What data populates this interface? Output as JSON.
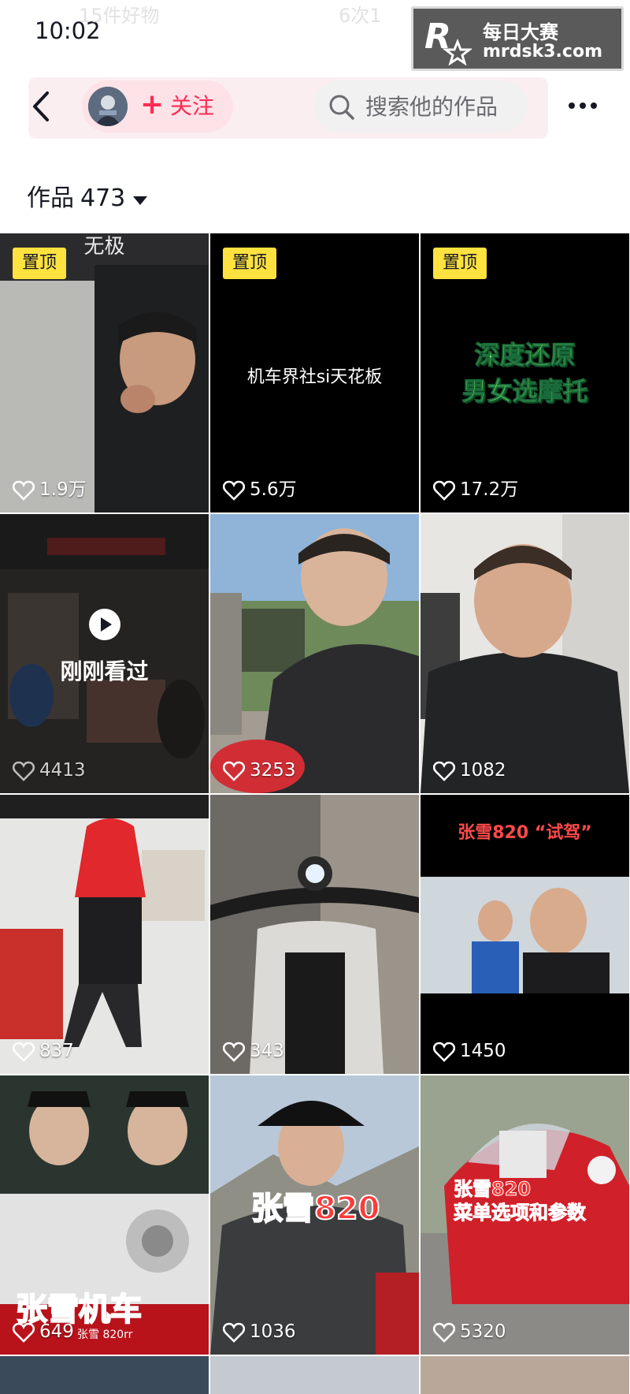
{
  "status_bar": {
    "time": "10:02",
    "ghost_text_left": "15件好物",
    "ghost_text_right": "6次1"
  },
  "watermark": {
    "logo_letter": "R",
    "title": "每日大赛",
    "url": "mrdsk3.com"
  },
  "nav": {
    "follow_label": "关注",
    "follow_plus": "+",
    "search_placeholder": "搜索他的作品"
  },
  "works_header": {
    "label": "作品",
    "count": "473"
  },
  "tiles": [
    {
      "pinned": true,
      "pin_label": "置顶",
      "top_text": "无极",
      "likes": "1.9万"
    },
    {
      "pinned": true,
      "pin_label": "置顶",
      "caption": "机车界社si天花板",
      "likes": "5.6万"
    },
    {
      "pinned": true,
      "pin_label": "置顶",
      "green_line1": "深度还原",
      "green_line2": "男女选摩托",
      "likes": "17.2万"
    },
    {
      "watched_label": "刚刚看过",
      "likes": "4413"
    },
    {
      "likes": "3253"
    },
    {
      "likes": "1082"
    },
    {
      "likes": "837"
    },
    {
      "likes": "343"
    },
    {
      "title": "张雪820 “试驾”",
      "likes": "1450"
    },
    {
      "red_text": "张雪机车",
      "small_text": "张雪 820rr",
      "likes": "649"
    },
    {
      "red_text": "张雪820",
      "likes": "1036"
    },
    {
      "red_line1": "张雪820",
      "red_line2": "菜单选项和参数",
      "likes": "5320"
    }
  ],
  "colors": {
    "accent": "#fe2c55",
    "pin_badge": "#ffe23f",
    "follow_pill": "#fde3e8",
    "search_pill": "#f1f1f2"
  }
}
